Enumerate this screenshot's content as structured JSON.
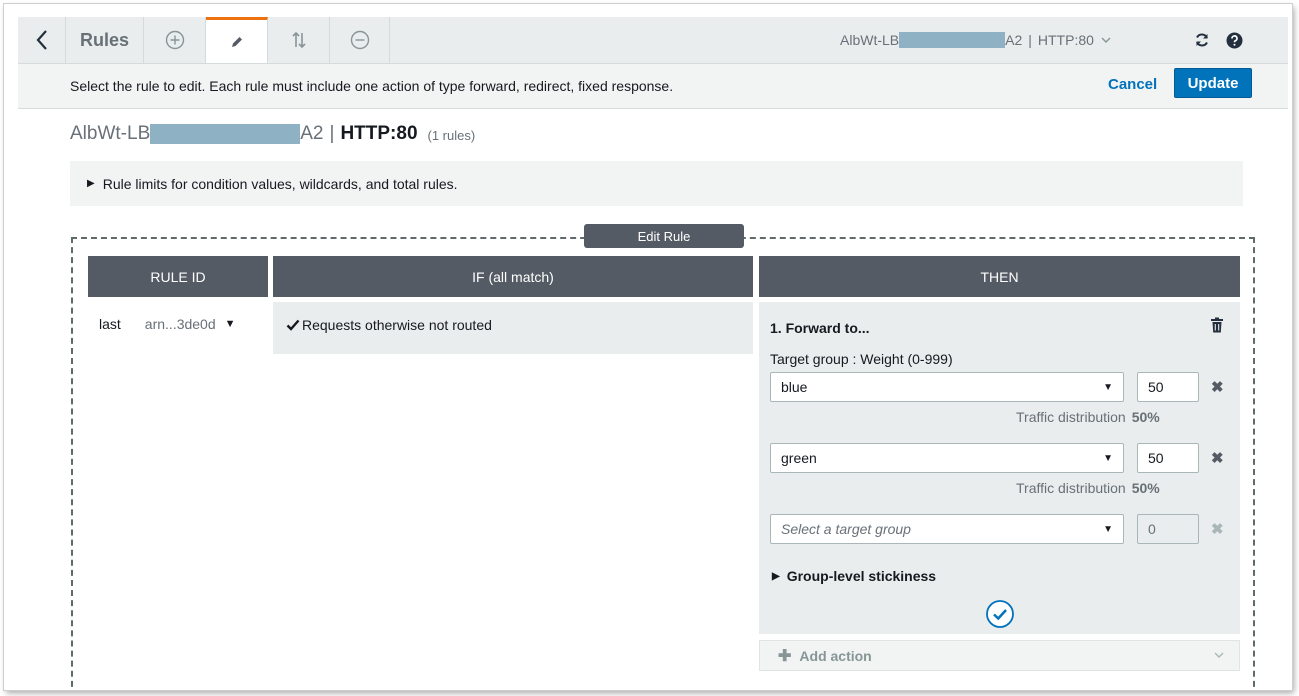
{
  "toolbar": {
    "title": "Rules",
    "lb_prefix": "AlbWt-LB",
    "lb_suffix": "A2",
    "listener": "HTTP:80"
  },
  "instruction": {
    "text": "Select the rule to edit. Each rule must include one action of type forward, redirect, fixed response.",
    "cancel_label": "Cancel",
    "update_label": "Update"
  },
  "heading": {
    "lb_prefix": "AlbWt-LB",
    "lb_suffix": "A2",
    "separator": "|",
    "listener": "HTTP:80",
    "count": "(1 rules)"
  },
  "limits": {
    "text": "Rule limits for condition values, wildcards, and total rules."
  },
  "edit_rule": {
    "label": "Edit Rule",
    "columns": {
      "rule_id": "RULE ID",
      "if": "IF (all match)",
      "then": "THEN"
    },
    "rule": {
      "priority": "last",
      "arn": "arn...3de0d",
      "condition": "Requests otherwise not routed"
    },
    "action": {
      "title": "1. Forward to...",
      "target_label": "Target group : Weight (0-999)",
      "dist_label": "Traffic distribution",
      "targets": [
        {
          "name": "blue",
          "weight": "50",
          "dist": "50%"
        },
        {
          "name": "green",
          "weight": "50",
          "dist": "50%"
        }
      ],
      "empty_target": {
        "placeholder": "Select a target group",
        "weight": "0"
      },
      "stickiness": "Group-level stickiness"
    },
    "add_action": "Add action"
  },
  "colors": {
    "accent": "#0073bb",
    "active_tab": "#ec7211",
    "header_bg": "#545b64"
  }
}
